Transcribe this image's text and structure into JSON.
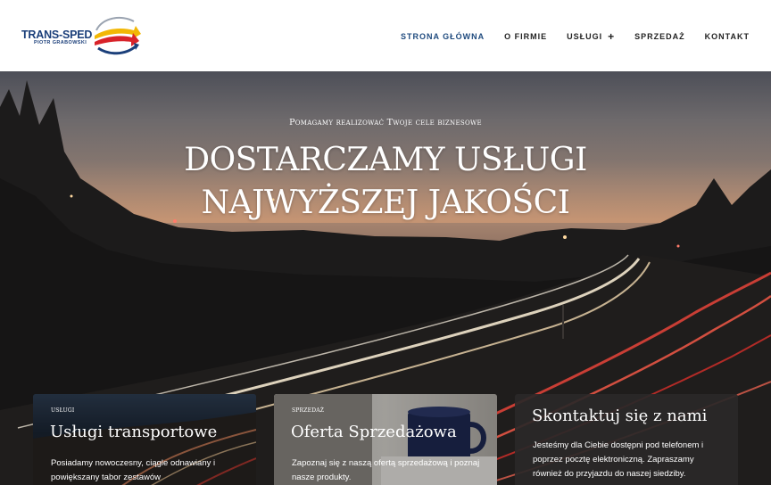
{
  "header": {
    "logo": {
      "name": "TRANS-SPED",
      "subtitle": "PIOTR GRABOWSKI"
    },
    "nav": [
      {
        "label": "STRONA GŁÓWNA",
        "active": true
      },
      {
        "label": "O FIRMIE",
        "active": false
      },
      {
        "label": "USŁUGI",
        "active": false,
        "has_submenu": true,
        "submenu_icon": "+"
      },
      {
        "label": "SPRZEDAŻ",
        "active": false
      },
      {
        "label": "KONTAKT",
        "active": false
      }
    ]
  },
  "hero": {
    "kicker": "Pomagamy realizować Twoje cele biznesowe",
    "title_line1": "DOSTARCZAMY USŁUGI",
    "title_line2": "NAJWYŻSZEJ JAKOŚCI"
  },
  "cards": [
    {
      "kicker": "usługi",
      "title": "Usługi transportowe",
      "text": "Posiadamy nowoczesny, ciągle odnawiany i powiększany tabor zestawów"
    },
    {
      "kicker": "sprzedaż",
      "title": "Oferta Sprzedażowa",
      "text": "Zapoznaj się z naszą ofertą sprzedażową i poznaj nasze produkty."
    },
    {
      "kicker": "",
      "title": "Skontaktuj się z nami",
      "text": "Jesteśmy dla Ciebie dostępni pod telefonem i poprzez pocztę elektroniczną. Zapraszamy również do przyjazdu do naszej siedziby."
    }
  ],
  "colors": {
    "nav_active": "#1e4a7e",
    "nav_text": "#222222",
    "logo_blue": "#1b3f7a",
    "logo_red": "#d8232a",
    "logo_yellow": "#f2b705"
  }
}
